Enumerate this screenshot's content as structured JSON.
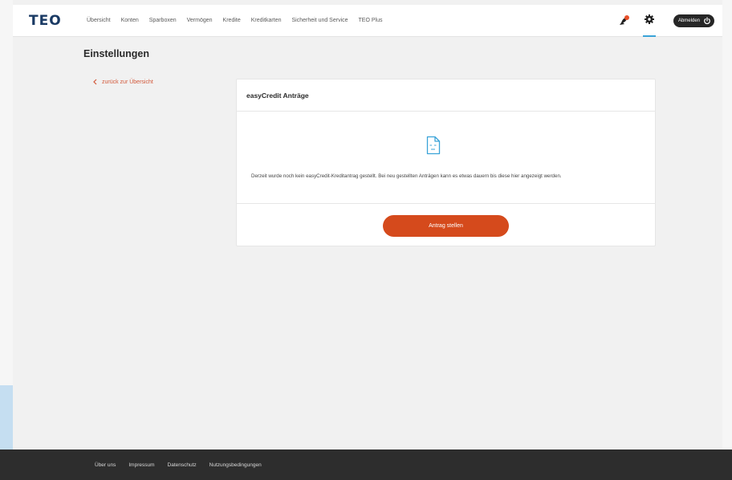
{
  "header": {
    "logo": "TEO",
    "nav": [
      "Übersicht",
      "Konten",
      "Sparboxen",
      "Vermögen",
      "Kredite",
      "Kreditkarten",
      "Sicherheit und Service",
      "TEO Plus"
    ],
    "logout_label": "Abmelden",
    "icons": {
      "rocket": "rocket-icon",
      "settings": "gear-icon",
      "power": "power-icon"
    }
  },
  "page": {
    "title": "Einstellungen",
    "back_link": "zurück zur Übersicht"
  },
  "card": {
    "title": "easyCredit Anträge",
    "message": "Derzeit wurde noch kein easyCredit-Kreditantrag gestellt. Bei neu gestellten Anträgen kann es etwas dauern bis diese hier angezeigt werden.",
    "button_label": "Antrag stellen"
  },
  "footer": {
    "links": [
      "Über uns",
      "Impressum",
      "Datenschutz",
      "Nutzungsbedingungen"
    ]
  },
  "colors": {
    "brand_navy": "#1a3a64",
    "accent_orange": "#d54a1c",
    "active_blue": "#3aa3d8",
    "footer_bg": "#2d2d2d"
  }
}
